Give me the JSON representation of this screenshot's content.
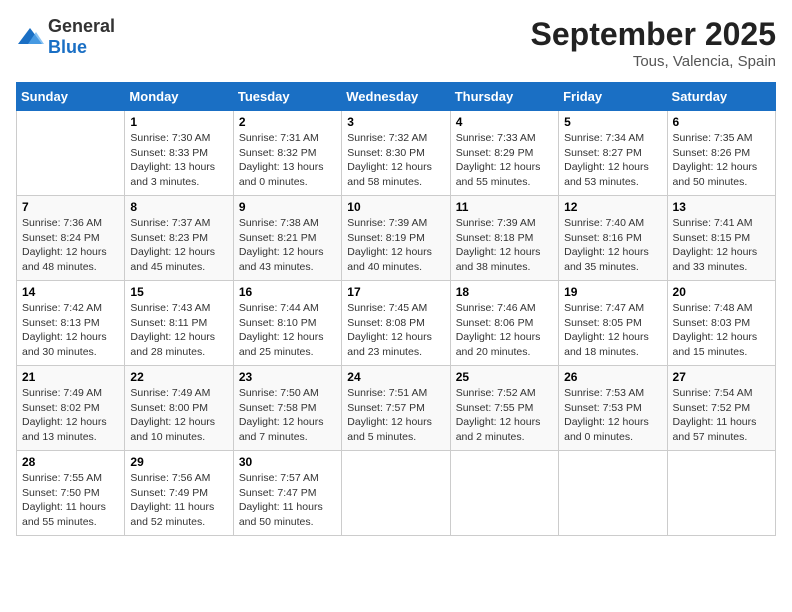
{
  "logo": {
    "general": "General",
    "blue": "Blue"
  },
  "title": "September 2025",
  "subtitle": "Tous, Valencia, Spain",
  "headers": [
    "Sunday",
    "Monday",
    "Tuesday",
    "Wednesday",
    "Thursday",
    "Friday",
    "Saturday"
  ],
  "weeks": [
    [
      {
        "day": "",
        "info": ""
      },
      {
        "day": "1",
        "info": "Sunrise: 7:30 AM\nSunset: 8:33 PM\nDaylight: 13 hours\nand 3 minutes."
      },
      {
        "day": "2",
        "info": "Sunrise: 7:31 AM\nSunset: 8:32 PM\nDaylight: 13 hours\nand 0 minutes."
      },
      {
        "day": "3",
        "info": "Sunrise: 7:32 AM\nSunset: 8:30 PM\nDaylight: 12 hours\nand 58 minutes."
      },
      {
        "day": "4",
        "info": "Sunrise: 7:33 AM\nSunset: 8:29 PM\nDaylight: 12 hours\nand 55 minutes."
      },
      {
        "day": "5",
        "info": "Sunrise: 7:34 AM\nSunset: 8:27 PM\nDaylight: 12 hours\nand 53 minutes."
      },
      {
        "day": "6",
        "info": "Sunrise: 7:35 AM\nSunset: 8:26 PM\nDaylight: 12 hours\nand 50 minutes."
      }
    ],
    [
      {
        "day": "7",
        "info": "Sunrise: 7:36 AM\nSunset: 8:24 PM\nDaylight: 12 hours\nand 48 minutes."
      },
      {
        "day": "8",
        "info": "Sunrise: 7:37 AM\nSunset: 8:23 PM\nDaylight: 12 hours\nand 45 minutes."
      },
      {
        "day": "9",
        "info": "Sunrise: 7:38 AM\nSunset: 8:21 PM\nDaylight: 12 hours\nand 43 minutes."
      },
      {
        "day": "10",
        "info": "Sunrise: 7:39 AM\nSunset: 8:19 PM\nDaylight: 12 hours\nand 40 minutes."
      },
      {
        "day": "11",
        "info": "Sunrise: 7:39 AM\nSunset: 8:18 PM\nDaylight: 12 hours\nand 38 minutes."
      },
      {
        "day": "12",
        "info": "Sunrise: 7:40 AM\nSunset: 8:16 PM\nDaylight: 12 hours\nand 35 minutes."
      },
      {
        "day": "13",
        "info": "Sunrise: 7:41 AM\nSunset: 8:15 PM\nDaylight: 12 hours\nand 33 minutes."
      }
    ],
    [
      {
        "day": "14",
        "info": "Sunrise: 7:42 AM\nSunset: 8:13 PM\nDaylight: 12 hours\nand 30 minutes."
      },
      {
        "day": "15",
        "info": "Sunrise: 7:43 AM\nSunset: 8:11 PM\nDaylight: 12 hours\nand 28 minutes."
      },
      {
        "day": "16",
        "info": "Sunrise: 7:44 AM\nSunset: 8:10 PM\nDaylight: 12 hours\nand 25 minutes."
      },
      {
        "day": "17",
        "info": "Sunrise: 7:45 AM\nSunset: 8:08 PM\nDaylight: 12 hours\nand 23 minutes."
      },
      {
        "day": "18",
        "info": "Sunrise: 7:46 AM\nSunset: 8:06 PM\nDaylight: 12 hours\nand 20 minutes."
      },
      {
        "day": "19",
        "info": "Sunrise: 7:47 AM\nSunset: 8:05 PM\nDaylight: 12 hours\nand 18 minutes."
      },
      {
        "day": "20",
        "info": "Sunrise: 7:48 AM\nSunset: 8:03 PM\nDaylight: 12 hours\nand 15 minutes."
      }
    ],
    [
      {
        "day": "21",
        "info": "Sunrise: 7:49 AM\nSunset: 8:02 PM\nDaylight: 12 hours\nand 13 minutes."
      },
      {
        "day": "22",
        "info": "Sunrise: 7:49 AM\nSunset: 8:00 PM\nDaylight: 12 hours\nand 10 minutes."
      },
      {
        "day": "23",
        "info": "Sunrise: 7:50 AM\nSunset: 7:58 PM\nDaylight: 12 hours\nand 7 minutes."
      },
      {
        "day": "24",
        "info": "Sunrise: 7:51 AM\nSunset: 7:57 PM\nDaylight: 12 hours\nand 5 minutes."
      },
      {
        "day": "25",
        "info": "Sunrise: 7:52 AM\nSunset: 7:55 PM\nDaylight: 12 hours\nand 2 minutes."
      },
      {
        "day": "26",
        "info": "Sunrise: 7:53 AM\nSunset: 7:53 PM\nDaylight: 12 hours\nand 0 minutes."
      },
      {
        "day": "27",
        "info": "Sunrise: 7:54 AM\nSunset: 7:52 PM\nDaylight: 11 hours\nand 57 minutes."
      }
    ],
    [
      {
        "day": "28",
        "info": "Sunrise: 7:55 AM\nSunset: 7:50 PM\nDaylight: 11 hours\nand 55 minutes."
      },
      {
        "day": "29",
        "info": "Sunrise: 7:56 AM\nSunset: 7:49 PM\nDaylight: 11 hours\nand 52 minutes."
      },
      {
        "day": "30",
        "info": "Sunrise: 7:57 AM\nSunset: 7:47 PM\nDaylight: 11 hours\nand 50 minutes."
      },
      {
        "day": "",
        "info": ""
      },
      {
        "day": "",
        "info": ""
      },
      {
        "day": "",
        "info": ""
      },
      {
        "day": "",
        "info": ""
      }
    ]
  ]
}
